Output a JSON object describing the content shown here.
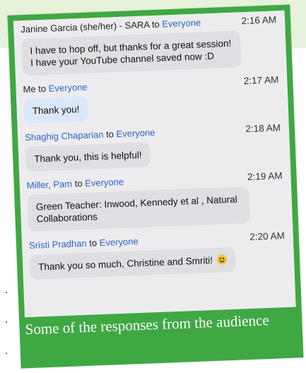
{
  "messages": [
    {
      "sender": "Janine Garcia (she/her) - SARA",
      "to": "to",
      "target": "Everyone",
      "time": "2:16 AM",
      "text": "I have to hop off, but thanks for a great session! I have your YouTube channel saved now :D"
    },
    {
      "sender": "Me",
      "to": "to",
      "target": "Everyone",
      "time": "2:17 AM",
      "text": "Thank you!"
    },
    {
      "sender": "Shaghig Chaparian",
      "to": "to",
      "target": "Everyone",
      "time": "2:18 AM",
      "text": "Thank you, this is helpful!"
    },
    {
      "sender": "Miller, Pam",
      "to": "to",
      "target": "Everyone",
      "time": "2:19 AM",
      "text": "Green Teacher: Inwood, Kennedy et al , Natural Collaborations"
    },
    {
      "sender": "Sristi Pradhan",
      "to": "to",
      "target": "Everyone",
      "time": "2:20 AM",
      "text": "Thank you so much, Christine and Smriti!",
      "emoji": "smiling-face-emoji"
    }
  ],
  "caption": "Some of the responses from the audience",
  "colors": {
    "frame_green": "#3fa843",
    "chat_background": "#ececef",
    "bubble": "#dedee3",
    "own_bubble": "#dbe8fa",
    "link_blue": "#2a63c8",
    "slide_band": "#e6f2d9"
  }
}
